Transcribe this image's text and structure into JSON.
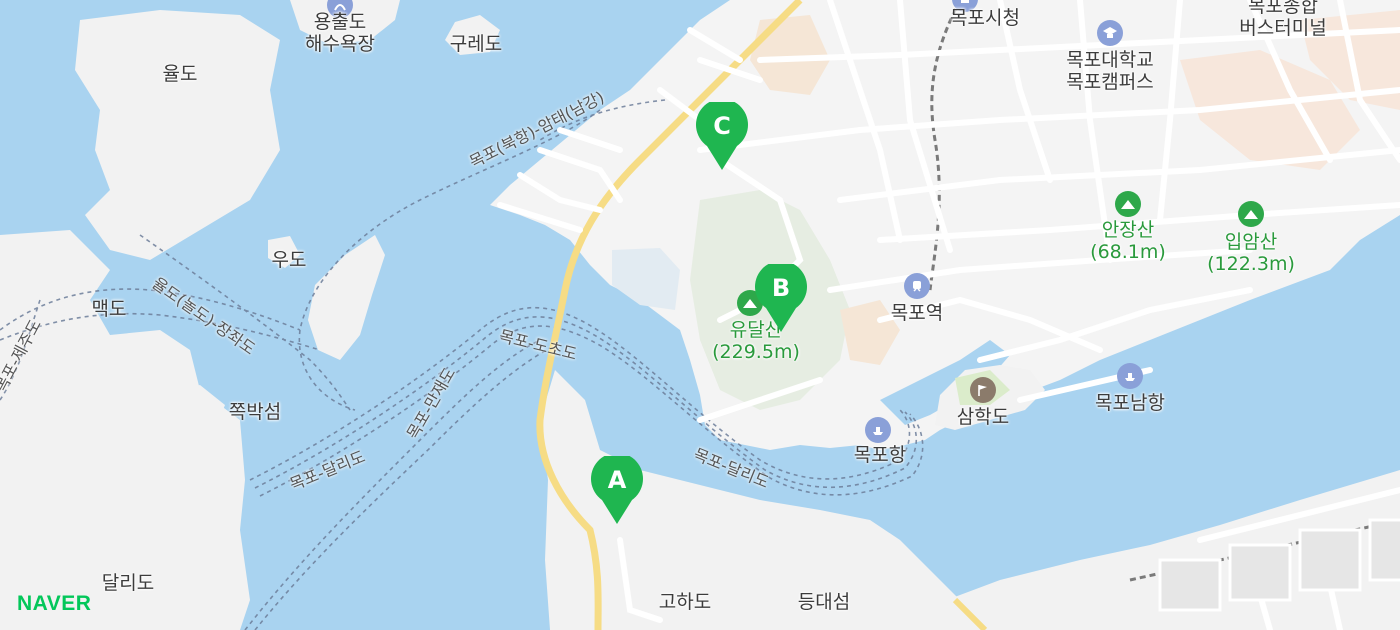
{
  "map": {
    "brand": "NAVER",
    "markers": [
      {
        "id": "A",
        "label": "A"
      },
      {
        "id": "B",
        "label": "B"
      },
      {
        "id": "C",
        "label": "C"
      }
    ],
    "places": {
      "yongchuldo_beach": "용출도\n해수욕장",
      "guredo": "구레도",
      "yuldo": "율도",
      "udo": "우도",
      "maekdo": "맥도",
      "jjokbakseom": "쪽박섬",
      "dallido": "달리도",
      "gohado": "고하도",
      "deungdaeseom": "등대섬",
      "mokpo_city_hall": "목포시청",
      "mokpo_terminal": "목포종합\n버스터미널",
      "mokpo_univ": "목포대학교\n목포캠퍼스",
      "yudalsan": "유달산\n(229.5m)",
      "anjangsan": "안장산\n(68.1m)",
      "ipamsan": "입암산\n(122.3m)",
      "mokpo_station": "목포역",
      "samhakdo": "삼학도",
      "mokpo_south_port": "목포남항",
      "mokpo_port": "목포항"
    },
    "routes": {
      "mokpo_amtae": "목포(북항)-암태(남강)",
      "yuldo_jangjwado": "율도(놀도)-장좌도",
      "mokpo_jeju": "목포-제주도",
      "mokpo_docho": "목포-도초도",
      "mokpo_manjaedo": "목포-만재도",
      "mokpo_dallido_west": "목포-달리도",
      "mokpo_dallido_east": "목포-달리도"
    }
  }
}
